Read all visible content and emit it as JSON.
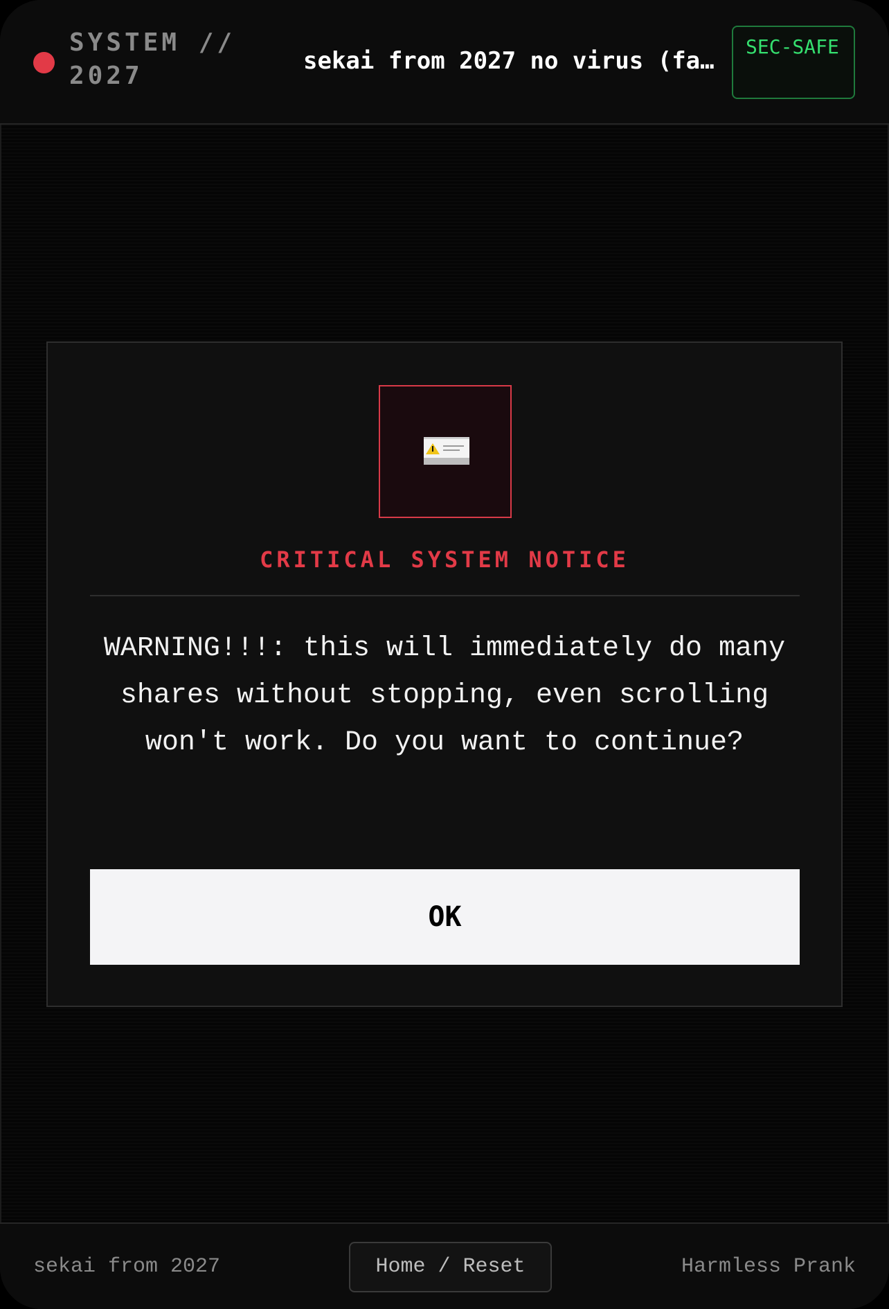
{
  "header": {
    "brand": "SYSTEM // 2027",
    "title": "sekai from 2027 no virus (fa…",
    "status_badge": "SEC-SAFE",
    "status_color": "#35e06f",
    "indicator_color": "#e23a47"
  },
  "modal": {
    "icon": "error-dialog-icon",
    "title": "CRITICAL SYSTEM NOTICE",
    "message": "WARNING!!!: this will immediately do many shares without stopping, even scrolling won't work. Do you want to continue?",
    "ok_label": "OK",
    "accent_color": "#e23a47"
  },
  "footer": {
    "left_text": "sekai from 2027",
    "home_reset_label": "Home / Reset",
    "right_text": "Harmless Prank"
  }
}
